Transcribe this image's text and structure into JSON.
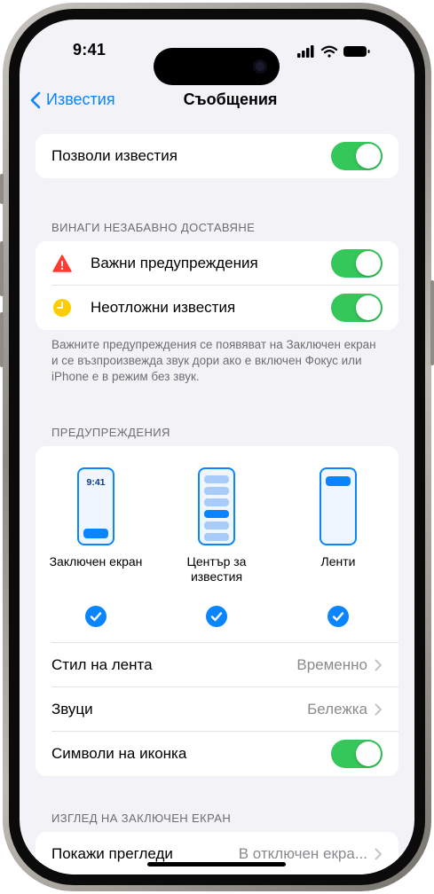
{
  "status_bar": {
    "time": "9:41"
  },
  "nav": {
    "back_label": "Известия",
    "title": "Съобщения"
  },
  "allow": {
    "label": "Позволи известия",
    "enabled": true
  },
  "deliver_now": {
    "header": "ВИНАГИ НЕЗАБАВНО ДОСТАВЯНЕ",
    "items": [
      {
        "label": "Важни предупреждения",
        "icon": "warning-triangle-icon",
        "icon_color": "#ff3b30",
        "enabled": true
      },
      {
        "label": "Неотложни известия",
        "icon": "clock-icon",
        "icon_color": "#ffcc00",
        "enabled": true
      }
    ],
    "footnote": "Важните предупреждения се появяват на Заключен екран и се възпроизвежда звук дори ако е включен Фокус или iPhone е в режим без звук."
  },
  "alerts": {
    "header": "ПРЕДУПРЕЖДЕНИЯ",
    "mini_time": "9:41",
    "options": [
      {
        "label": "Заключен екран",
        "checked": true
      },
      {
        "label": "Център за известия",
        "checked": true
      },
      {
        "label": "Ленти",
        "checked": true
      }
    ],
    "rows": [
      {
        "label": "Стил на лента",
        "value": "Временно"
      },
      {
        "label": "Звуци",
        "value": "Бележка"
      }
    ],
    "badges": {
      "label": "Символи на иконка",
      "enabled": true
    }
  },
  "lock_screen": {
    "header": "ИЗГЛЕД НА ЗАКЛЮЧЕН ЕКРАН",
    "show_previews": {
      "label": "Покажи прегледи",
      "value": "В отключен екра..."
    }
  },
  "colors": {
    "accent": "#0a84ff",
    "toggle_on": "#34c759",
    "background": "#f2f2f7"
  }
}
